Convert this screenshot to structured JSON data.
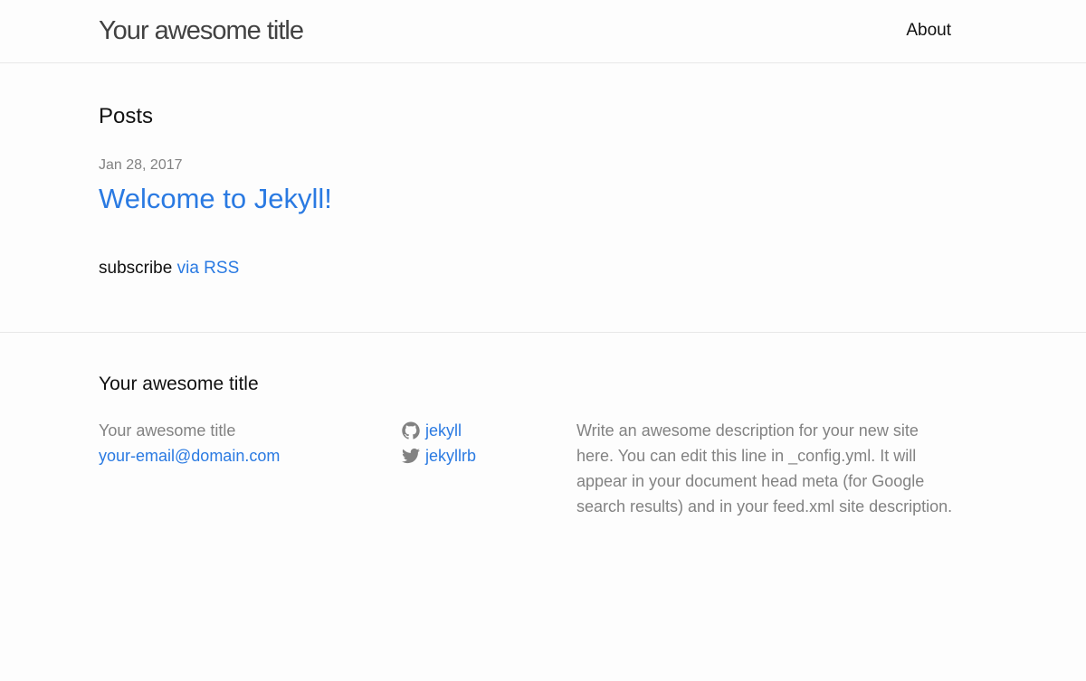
{
  "header": {
    "site_title": "Your awesome title",
    "nav": [
      {
        "label": "About"
      }
    ]
  },
  "main": {
    "heading": "Posts",
    "posts": [
      {
        "date": "Jan 28, 2017",
        "title": "Welcome to Jekyll!"
      }
    ],
    "rss": {
      "prefix": "subscribe",
      "link_label": "via RSS"
    }
  },
  "footer": {
    "heading": "Your awesome title",
    "name": "Your awesome title",
    "email": "your-email@domain.com",
    "social": [
      {
        "icon": "github-icon",
        "username": "jekyll"
      },
      {
        "icon": "twitter-icon",
        "username": "jekyllrb"
      }
    ],
    "description": "Write an awesome description for your new site here. You can edit this line in _config.yml. It will appear in your document head meta (for Google search results) and in your feed.xml site description."
  },
  "colors": {
    "link": "#2a7ae2",
    "muted": "#828282",
    "text": "#111111",
    "border": "#e8e8e8",
    "background": "#fdfdfd"
  }
}
